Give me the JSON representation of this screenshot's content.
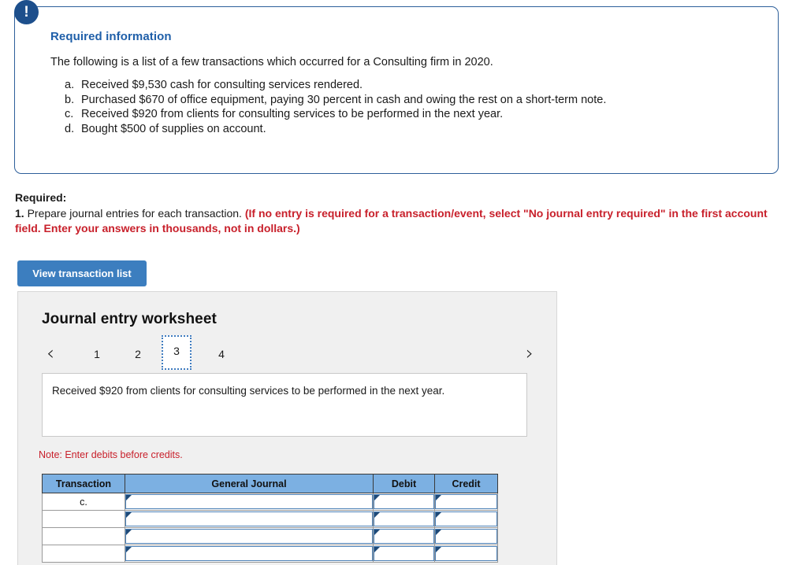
{
  "required_info": {
    "badge_icon": "exclamation-icon",
    "heading": "Required information",
    "intro": "The following is a list of a few transactions which occurred for a Consulting firm in 2020.",
    "items": [
      {
        "marker": "a.",
        "text": "Received $9,530 cash for consulting services rendered."
      },
      {
        "marker": "b.",
        "text": "Purchased $670 of office equipment, paying 30 percent in cash and owing the rest on a short-term note."
      },
      {
        "marker": "c.",
        "text": "Received $920 from clients for consulting services to be performed in the next year."
      },
      {
        "marker": "d.",
        "text": "Bought $500 of supplies on account."
      }
    ]
  },
  "required_block": {
    "label": "Required:",
    "number": "1.",
    "statement": " Prepare journal entries for each transaction. ",
    "red_note": "(If no entry is required for a transaction/event, select \"No journal entry required\" in the first account field. Enter your answers in thousands, not in dollars.)"
  },
  "buttons": {
    "view_transaction_list": "View transaction list"
  },
  "worksheet": {
    "title": "Journal entry worksheet",
    "prev_icon": "chevron-left-icon",
    "next_icon": "chevron-right-icon",
    "prev_glyph": "‹",
    "next_glyph": "›",
    "tabs": [
      "1",
      "2",
      "3",
      "4"
    ],
    "selected_tab_index": 2,
    "description": "Received $920 from clients for consulting services to be performed in the next year.",
    "note": "Note: Enter debits before credits.",
    "table": {
      "headers": [
        "Transaction",
        "General Journal",
        "Debit",
        "Credit"
      ],
      "rows": [
        {
          "transaction": "c.",
          "general_journal": "",
          "debit": "",
          "credit": ""
        },
        {
          "transaction": "",
          "general_journal": "",
          "debit": "",
          "credit": ""
        },
        {
          "transaction": "",
          "general_journal": "",
          "debit": "",
          "credit": ""
        },
        {
          "transaction": "",
          "general_journal": "",
          "debit": "",
          "credit": ""
        }
      ]
    }
  },
  "colors": {
    "panel_border": "#2d5f9a",
    "badge": "#1d4f8c",
    "heading_blue": "#1f5fa9",
    "red": "#c8202b",
    "button_blue": "#3c7ebf",
    "table_header_blue": "#7cb0e2",
    "cell_border_blue": "#4a7fb5",
    "panel_gray": "#f0f0f0"
  }
}
